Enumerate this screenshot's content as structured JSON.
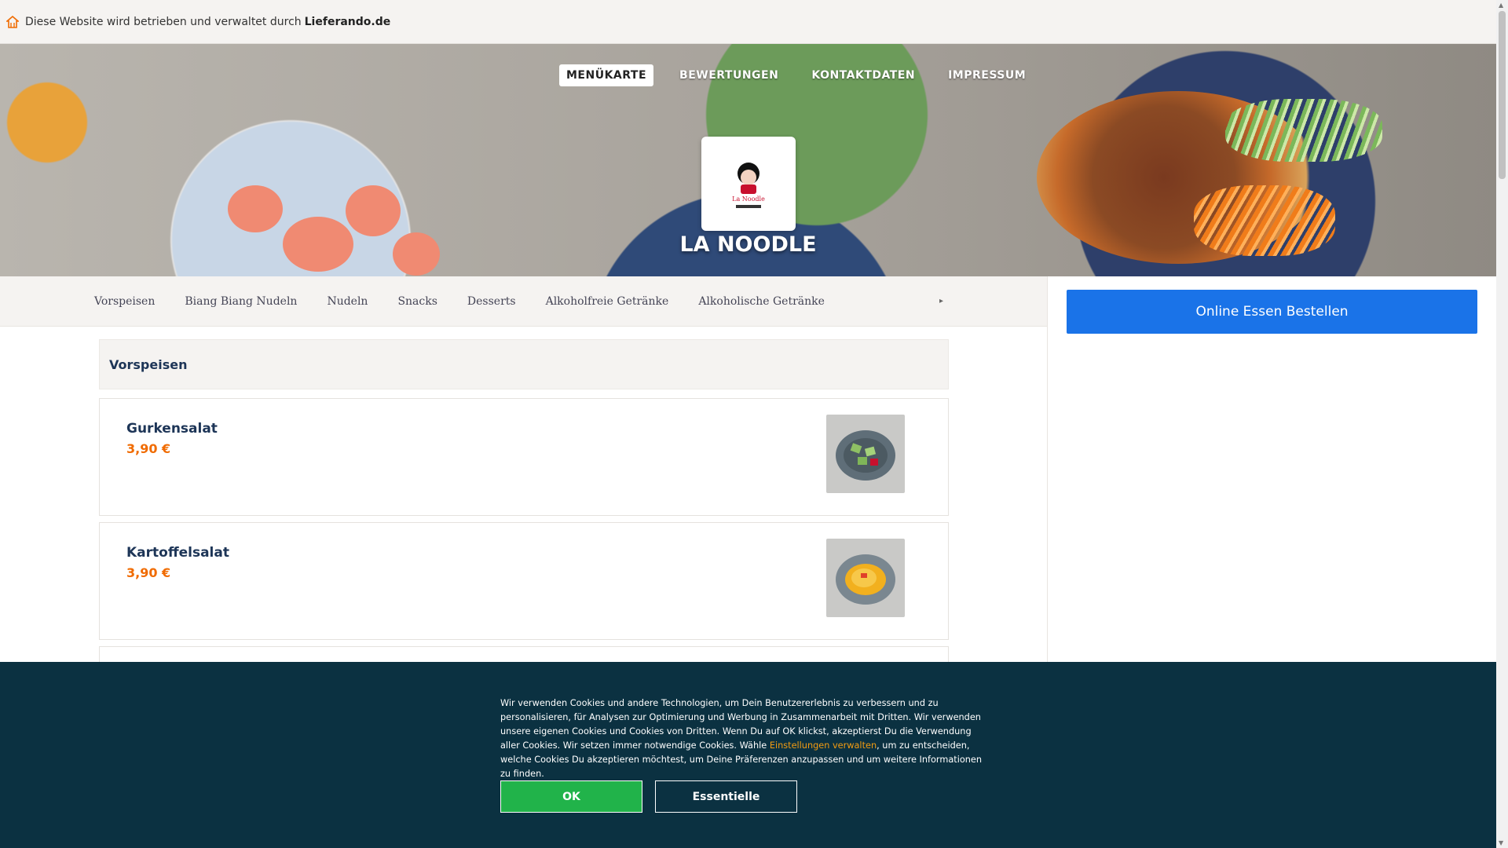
{
  "operator_bar": {
    "text": "Diese Website wird betrieben und verwaltet durch",
    "brand": "Lieferando.de",
    "icon": "home-icon"
  },
  "hero": {
    "nav": [
      {
        "label": "MENÜKARTE",
        "active": true
      },
      {
        "label": "BEWERTUNGEN",
        "active": false
      },
      {
        "label": "KONTAKTDATEN",
        "active": false
      },
      {
        "label": "IMPRESSUM",
        "active": false
      }
    ],
    "logo_text": "La Noodle",
    "restaurant_name": "LA NOODLE"
  },
  "categories": {
    "items": [
      "Vorspeisen",
      "Biang Biang Nudeln",
      "Nudeln",
      "Snacks",
      "Desserts",
      "Alkoholfreie Getränke",
      "Alkoholische Getränke"
    ],
    "more_icon": "chevron-right-icon"
  },
  "sidebar": {
    "order_button": "Online Essen Bestellen"
  },
  "menu": {
    "section_title": "Vorspeisen",
    "items": [
      {
        "name": "Gurkensalat",
        "price": "3,90 €",
        "image": "cucumber-salad"
      },
      {
        "name": "Kartoffelsalat",
        "price": "3,90 €",
        "image": "potato-salad"
      }
    ]
  },
  "cookie": {
    "text_before": "Wir verwenden Cookies und andere Technologien, um Dein Benutzererlebnis zu verbessern und zu personalisieren, für Analysen zur Optimierung und Werbung in Zusammenarbeit mit Dritten. Wir verwenden unsere eigenen Cookies und Cookies von Dritten. Wenn Du auf OK klickst, akzeptierst Du die Verwendung aller Cookies. Wir setzen immer notwendige Cookies. Wähle ",
    "link": "Einstellungen verwalten",
    "text_after": ", um zu entscheiden, welche Cookies Du akzeptieren möchtest, um Deine Präferenzen anzupassen und um weitere Informationen zu finden.",
    "ok_label": "OK",
    "essential_label": "Essentielle"
  },
  "colors": {
    "accent_blue": "#1a73e8",
    "price_orange": "#f06b00",
    "banner_bg": "#0b3141",
    "ok_green": "#21b34a"
  }
}
